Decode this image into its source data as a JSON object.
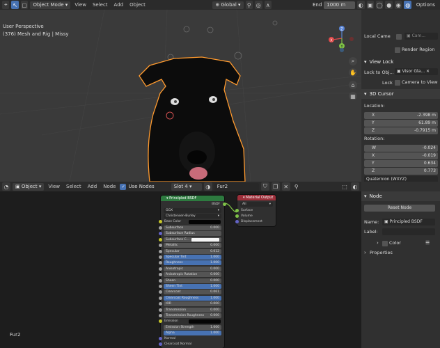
{
  "topbar": {
    "mode": "Object Mode",
    "menus": [
      "View",
      "Select",
      "Add",
      "Object"
    ],
    "transform": "Global",
    "options": "Options",
    "end_label": "End",
    "end_value": "1000 m"
  },
  "viewport": {
    "perspective": "User Perspective",
    "object_info": "(376) Mesh and Rig | Missy",
    "gizmo": {
      "x": "X",
      "y": "Y",
      "z": "Z"
    }
  },
  "sidebar": {
    "local_camera_label": "Local Came",
    "local_camera_value": "Cam...",
    "render_region": "Render Region",
    "view_lock": "View Lock",
    "lock_to_obj_label": "Lock to Obj...",
    "lock_to_obj_value": "Visor Gla...",
    "lock_label": "Lock",
    "camera_to_view": "Camera to View",
    "cursor_panel": "3D Cursor",
    "location_label": "Location:",
    "location": [
      {
        "axis": "X",
        "value": "-2.398 m"
      },
      {
        "axis": "Y",
        "value": "61.89 m"
      },
      {
        "axis": "Z",
        "value": "-0.7915 m"
      }
    ],
    "rotation_label": "Rotation:",
    "rotation": [
      {
        "axis": "W",
        "value": "-0.024"
      },
      {
        "axis": "X",
        "value": "-0.019"
      },
      {
        "axis": "Y",
        "value": "0.634"
      },
      {
        "axis": "Z",
        "value": "0.773"
      }
    ],
    "rotation_mode": "Quaternion (WXYZ)"
  },
  "node_header": {
    "type": "Object",
    "menus": [
      "View",
      "Select",
      "Add",
      "Node"
    ],
    "use_nodes": "Use Nodes",
    "slot": "Slot 4",
    "material": "Fur2"
  },
  "node_editor": {
    "material_label": "Fur2",
    "bsdf": {
      "title": "Principled BSDF",
      "output": "BSDF",
      "distribution": "GGX",
      "subsurface_method": "Christensen-Burley",
      "base_color": "Base Color",
      "rows": [
        {
          "label": "Subsurface",
          "value": "0.000",
          "blue": false
        },
        {
          "label": "Subsurface Radius",
          "value": "",
          "blue": false
        },
        {
          "label": "Subsurface C...",
          "value": "",
          "blue": false
        },
        {
          "label": "Metallic",
          "value": "0.000",
          "blue": false
        },
        {
          "label": "Specular",
          "value": "0.012",
          "blue": false
        },
        {
          "label": "Specular Tint",
          "value": "1.000",
          "blue": true
        },
        {
          "label": "Roughness",
          "value": "1.000",
          "blue": true
        },
        {
          "label": "Anisotropic",
          "value": "0.000",
          "blue": false
        },
        {
          "label": "Anisotropic Rotation",
          "value": "0.000",
          "blue": false
        },
        {
          "label": "Sheen",
          "value": "0.000",
          "blue": false
        },
        {
          "label": "Sheen Tint",
          "value": "1.000",
          "blue": true
        },
        {
          "label": "Clearcoat",
          "value": "0.061",
          "blue": false
        },
        {
          "label": "Clearcoat Roughness",
          "value": "1.000",
          "blue": true
        },
        {
          "label": "IOR",
          "value": "0.000",
          "blue": false
        },
        {
          "label": "Transmission",
          "value": "0.000",
          "blue": false
        },
        {
          "label": "Transmission Roughness",
          "value": "0.000",
          "blue": false
        }
      ],
      "emission": "Emission",
      "emission_strength": {
        "label": "Emission Strength",
        "value": "1.000"
      },
      "alpha": {
        "label": "Alpha",
        "value": "1.000"
      },
      "normal": "Normal",
      "clearcoat_normal": "Clearcoat Normal"
    },
    "output": {
      "title": "Material Output",
      "target": "All",
      "sockets": [
        "Surface",
        "Volume",
        "Displacement"
      ]
    }
  },
  "node_sidebar": {
    "tab": "Node",
    "reset": "Reset Node",
    "name_label": "Name:",
    "name_value": "Principled BSDF",
    "label_label": "Label:",
    "color": "Color",
    "properties": "Properties"
  },
  "colors": {
    "accent": "#4772b3",
    "bsdf_header": "#2d7a3f",
    "output_header": "#9c2f3a",
    "outline": "#ff9a2e"
  }
}
